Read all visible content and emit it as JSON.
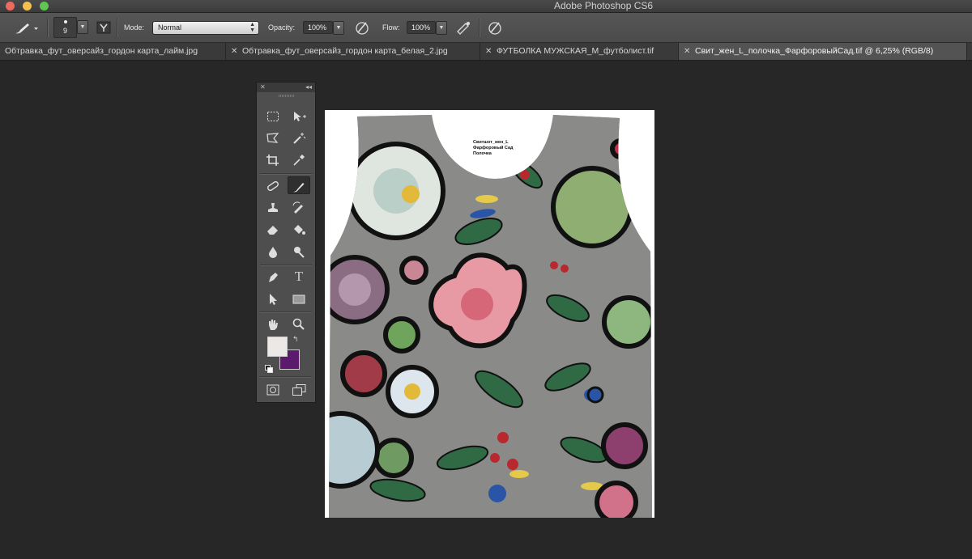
{
  "app": {
    "title": "Adobe Photoshop CS6"
  },
  "options_bar": {
    "brush_size": "9",
    "mode_label": "Mode:",
    "mode_value": "Normal",
    "opacity_label": "Opacity:",
    "opacity_value": "100%",
    "flow_label": "Flow:",
    "flow_value": "100%"
  },
  "tabs": [
    {
      "label": "Обтравка_фут_оверсайз_гордон карта_лайм.jpg",
      "active": false
    },
    {
      "label": "Обтравка_фут_оверсайз_гордон карта_белая_2.jpg",
      "active": false
    },
    {
      "label": "ФУТБОЛКА МУЖСКАЯ_М_футболист.tif",
      "active": false
    },
    {
      "label": "Свит_жен_L_полочка_ФарфоровыйСад.tif @ 6,25% (RGB/8)",
      "active": true
    }
  ],
  "tools_panel": {
    "tools": [
      "rectangular-marquee-icon",
      "move-icon",
      "polygonal-lasso-icon",
      "magic-wand-icon",
      "crop-icon",
      "eyedropper-icon",
      "healing-brush-icon",
      "brush-icon",
      "clone-stamp-icon",
      "history-brush-icon",
      "eraser-icon",
      "paint-bucket-icon",
      "blur-icon",
      "dodge-icon",
      "pen-icon",
      "type-icon",
      "path-selection-icon",
      "rectangle-shape-icon",
      "hand-icon",
      "zoom-icon"
    ],
    "type_tool_glyph": "T",
    "selected_tool": "brush-icon",
    "foreground_color": "#ece8e6",
    "background_color": "#5b1a6b"
  },
  "document": {
    "label_lines": [
      "Свитшот_жен_L",
      "Фарфоровый Сад",
      "Полочка"
    ]
  }
}
